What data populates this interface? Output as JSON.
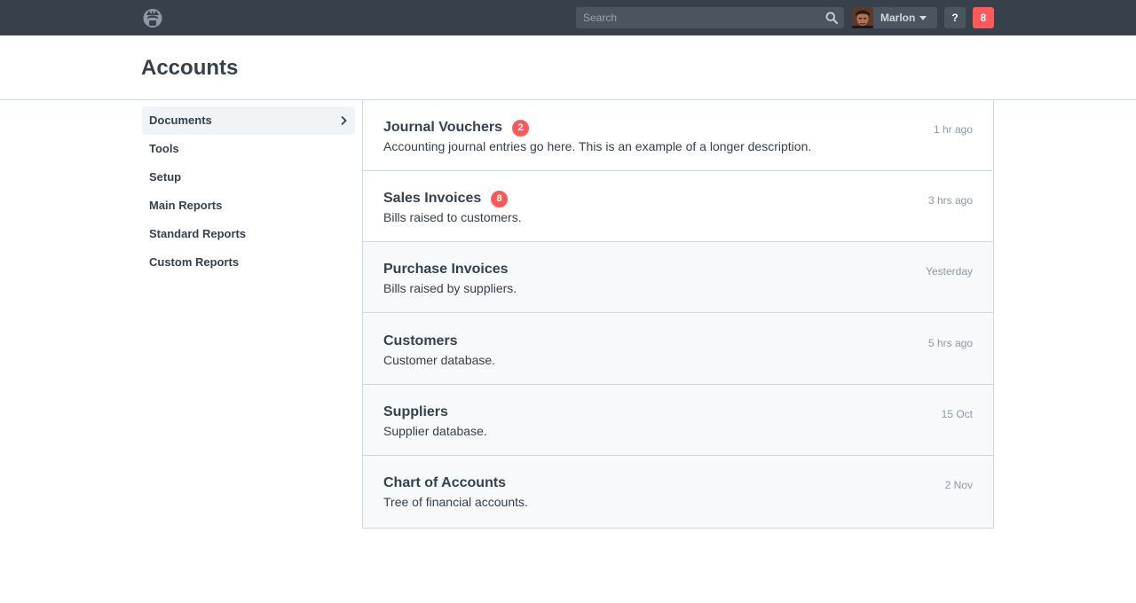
{
  "navbar": {
    "logo_icon": "app-logo-icon",
    "search": {
      "placeholder": "Search",
      "value": "",
      "icon": "search-icon"
    },
    "user": {
      "name": "Marlon",
      "avatar": "user-avatar-photo"
    },
    "help_label": "?",
    "notifications_count": "8",
    "colors": {
      "bar": "#36414c",
      "control": "#4a5560",
      "alert": "#ff5858"
    }
  },
  "page": {
    "title": "Accounts"
  },
  "sidebar": {
    "items": [
      {
        "label": "Documents",
        "active": true
      },
      {
        "label": "Tools"
      },
      {
        "label": "Setup"
      },
      {
        "label": "Main Reports"
      },
      {
        "label": "Standard Reports"
      },
      {
        "label": "Custom Reports"
      }
    ]
  },
  "list": {
    "items": [
      {
        "title": "Journal Vouchers",
        "badge": "2",
        "description": "Accounting journal entries go here. This is an example of a longer description.",
        "time": "1 hr ago"
      },
      {
        "title": "Sales Invoices",
        "badge": "8",
        "description": "Bills raised to customers.",
        "time": "3 hrs ago"
      },
      {
        "title": "Purchase Invoices",
        "description": "Bills raised by suppliers.",
        "time": "Yesterday"
      },
      {
        "title": "Customers",
        "description": "Customer database.",
        "time": "5 hrs ago"
      },
      {
        "title": "Suppliers",
        "description": "Supplier database.",
        "time": "15 Oct"
      },
      {
        "title": "Chart of Accounts",
        "description": "Tree of financial accounts.",
        "time": "2 Nov"
      }
    ]
  }
}
